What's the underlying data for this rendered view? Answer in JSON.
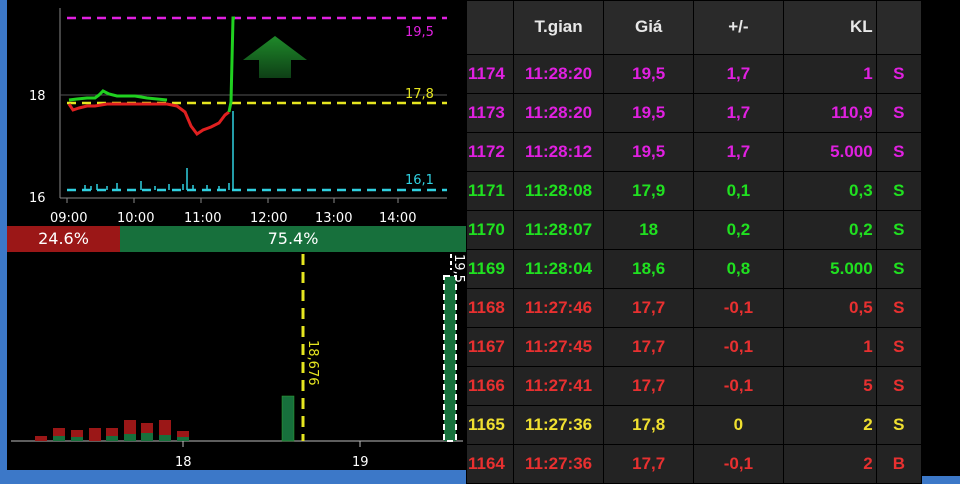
{
  "price_chart": {
    "ref_ceiling": "19,5",
    "ref_price": "17,8",
    "ref_floor": "16,1",
    "y_labels": [
      "18",
      "16"
    ],
    "x_labels": [
      "09:00",
      "10:00",
      "11:00",
      "12:00",
      "13:00",
      "14:00"
    ],
    "colors": {
      "ceiling": "#e020e0",
      "ref": "#e6e620",
      "floor": "#30d0e0",
      "up": "#20d020",
      "down": "#e02020"
    }
  },
  "ratio_bar": {
    "sell_pct": "24.6%",
    "buy_pct": "75.4%"
  },
  "volume_profile": {
    "x_labels": [
      "18",
      "19"
    ],
    "avg_price": "18,676",
    "ceiling_label": "19,5"
  },
  "trades_table": {
    "columns": [
      "",
      "T.gian",
      "Giá",
      "+/-",
      "KL",
      ""
    ],
    "rows": [
      {
        "id": "1174",
        "time": "11:28:20",
        "price": "19,5",
        "change": "1,7",
        "volume": "1",
        "side": "S",
        "color": "#e020e0"
      },
      {
        "id": "1173",
        "time": "11:28:20",
        "price": "19,5",
        "change": "1,7",
        "volume": "110,9",
        "side": "S",
        "color": "#e020e0"
      },
      {
        "id": "1172",
        "time": "11:28:12",
        "price": "19,5",
        "change": "1,7",
        "volume": "5.000",
        "side": "S",
        "color": "#e020e0"
      },
      {
        "id": "1171",
        "time": "11:28:08",
        "price": "17,9",
        "change": "0,1",
        "volume": "0,3",
        "side": "S",
        "color": "#20e020"
      },
      {
        "id": "1170",
        "time": "11:28:07",
        "price": "18",
        "change": "0,2",
        "volume": "0,2",
        "side": "S",
        "color": "#20e020"
      },
      {
        "id": "1169",
        "time": "11:28:04",
        "price": "18,6",
        "change": "0,8",
        "volume": "5.000",
        "side": "S",
        "color": "#20e020"
      },
      {
        "id": "1168",
        "time": "11:27:46",
        "price": "17,7",
        "change": "-0,1",
        "volume": "0,5",
        "side": "S",
        "color": "#e83030"
      },
      {
        "id": "1167",
        "time": "11:27:45",
        "price": "17,7",
        "change": "-0,1",
        "volume": "1",
        "side": "S",
        "color": "#e83030"
      },
      {
        "id": "1166",
        "time": "11:27:41",
        "price": "17,7",
        "change": "-0,1",
        "volume": "5",
        "side": "S",
        "color": "#e83030"
      },
      {
        "id": "1165",
        "time": "11:27:36",
        "price": "17,8",
        "change": "0",
        "volume": "2",
        "side": "S",
        "color": "#f0e030"
      },
      {
        "id": "1164",
        "time": "11:27:36",
        "price": "17,7",
        "change": "-0,1",
        "volume": "2",
        "side": "B",
        "color": "#e83030"
      }
    ]
  }
}
